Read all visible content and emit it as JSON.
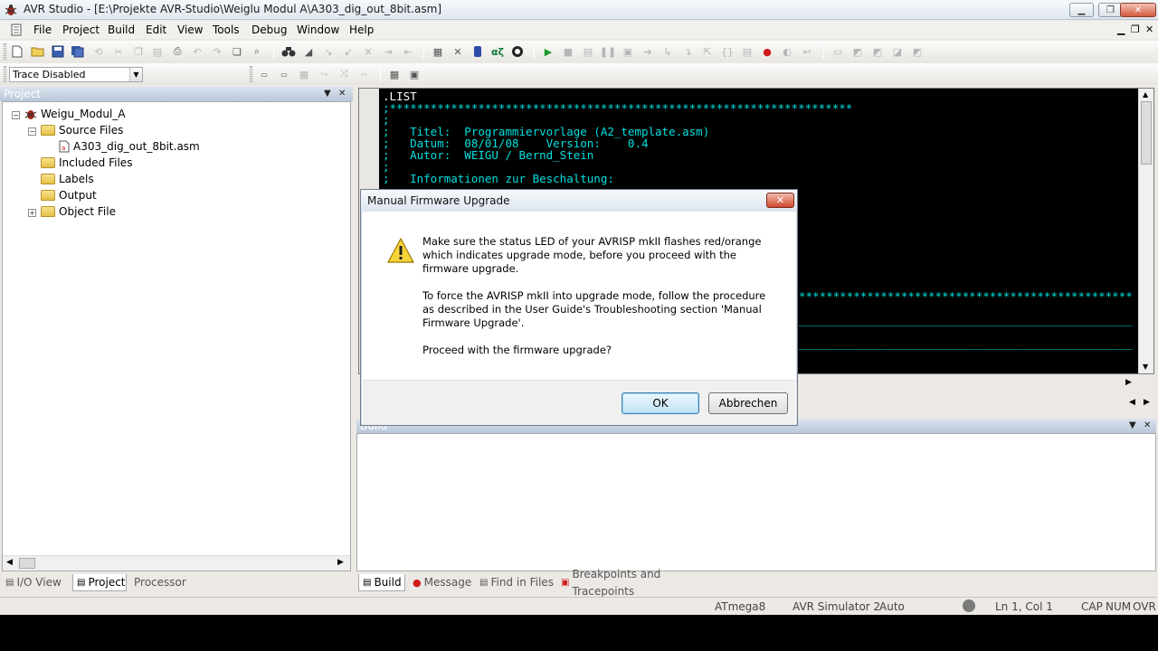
{
  "window": {
    "title": "AVR Studio - [E:\\Projekte AVR-Studio\\Weiglu Modul A\\A303_dig_out_8bit.asm]"
  },
  "menu": [
    "File",
    "Project",
    "Build",
    "Edit",
    "View",
    "Tools",
    "Debug",
    "Window",
    "Help"
  ],
  "trace": {
    "selected": "Trace Disabled"
  },
  "project_panel": {
    "title": "Project",
    "root": "Weigu_Modul_A",
    "source_files": "Source Files",
    "source_file": "A303_dig_out_8bit.asm",
    "included_files": "Included Files",
    "labels": "Labels",
    "output": "Output",
    "object_file": "Object File"
  },
  "left_tabs": [
    "I/O View",
    "Project",
    "Processor"
  ],
  "editor": {
    "lines": [
      ".LIST",
      ";********************************************************************",
      ";",
      ";   Titel:  Programmiervorlage (A2_template.asm)",
      ";   Datum:  08/01/08    Version:    0.4",
      ";   Autor:  WEIGU / Bernd_Stein",
      ";",
      ";   Informationen zur Beschaltung:"
    ],
    "lines_right": [
      "*************************************************",
      "_________________________________________________",
      "_________________________________________________"
    ]
  },
  "build_panel": {
    "title": "Build"
  },
  "bottom_tabs": [
    "Build",
    "Message",
    "Find in Files",
    "Breakpoints and Tracepoints"
  ],
  "status": {
    "device": "ATmega8",
    "platform": "AVR Simulator 2",
    "mode": "Auto",
    "position": "Ln 1, Col 1",
    "caps": "CAP",
    "num": "NUM",
    "ovr": "OVR"
  },
  "dialog": {
    "title": "Manual Firmware Upgrade",
    "para1": "Make sure the status LED of your AVRISP mkII flashes red/orange which indicates upgrade mode, before you proceed with the firmware upgrade.",
    "para2": "To force the AVRISP mkII into upgrade mode, follow the procedure as described in the User Guide's Troubleshooting section 'Manual Firmware Upgrade'.",
    "para3": "Proceed with the firmware upgrade?",
    "ok_label": "OK",
    "cancel_label": "Abbrechen"
  },
  "colors": {
    "code": "#00e0e0",
    "editor_bg": "#000000",
    "accent_close": "#cf4a2e"
  }
}
